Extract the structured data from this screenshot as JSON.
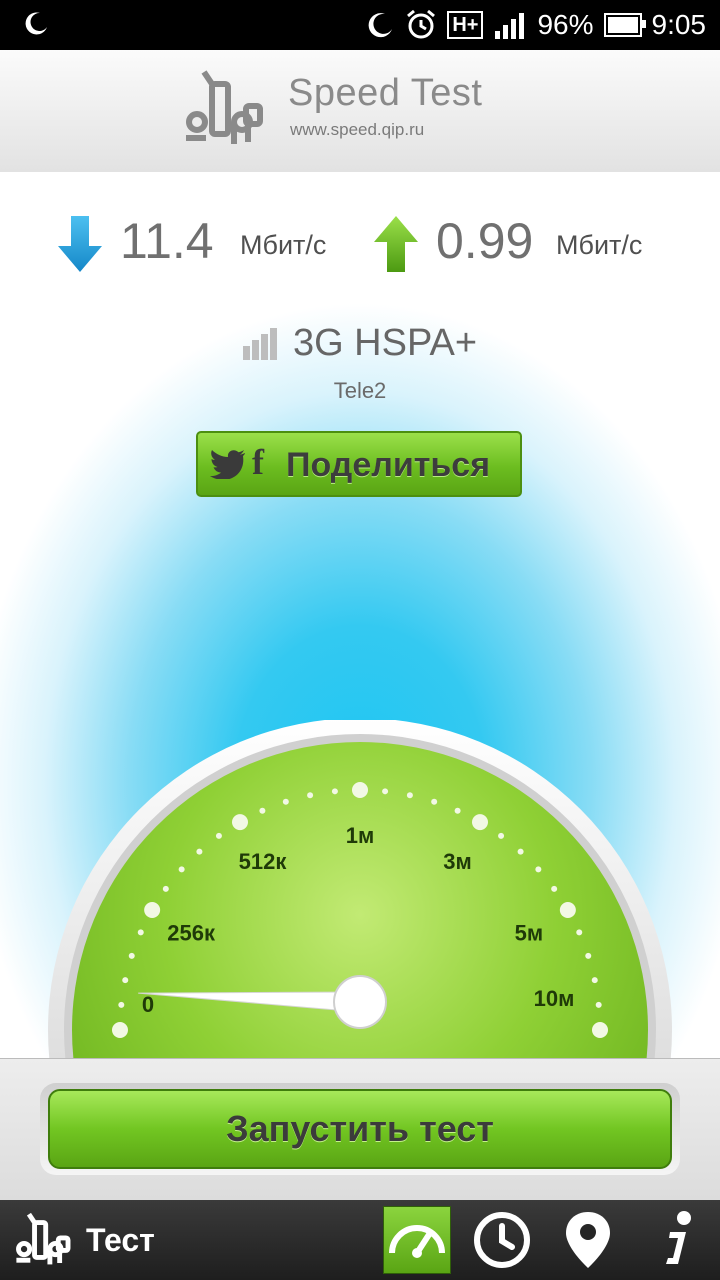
{
  "statusbar": {
    "battery": "96%",
    "time": "9:05",
    "network": "H+"
  },
  "header": {
    "title": "Speed Test",
    "url": "www.speed.qip.ru"
  },
  "speeds": {
    "download": {
      "value": "11.4",
      "unit": "Мбит/с"
    },
    "upload": {
      "value": "0.99",
      "unit": "Мбит/с"
    }
  },
  "network": {
    "type": "3G HSPA+",
    "carrier": "Tele2"
  },
  "share": {
    "label": "Поделиться",
    "facebook_glyph": "f"
  },
  "gauge": {
    "labels": [
      "0",
      "256к",
      "512к",
      "1м",
      "3м",
      "5м",
      "10м"
    ],
    "needle_value": 0,
    "colors": {
      "dial": "#7cc823",
      "rim": "#e0e0e0"
    }
  },
  "actions": {
    "start_label": "Запустить тест"
  },
  "nav": {
    "title": "Тест",
    "items": [
      "gauge",
      "history",
      "location",
      "info"
    ]
  },
  "colors": {
    "accent_green": "#6cbd20",
    "download_blue": "#1aa3e0",
    "upload_green": "#5fb51e",
    "sky_blue": "#1ec6f2"
  }
}
